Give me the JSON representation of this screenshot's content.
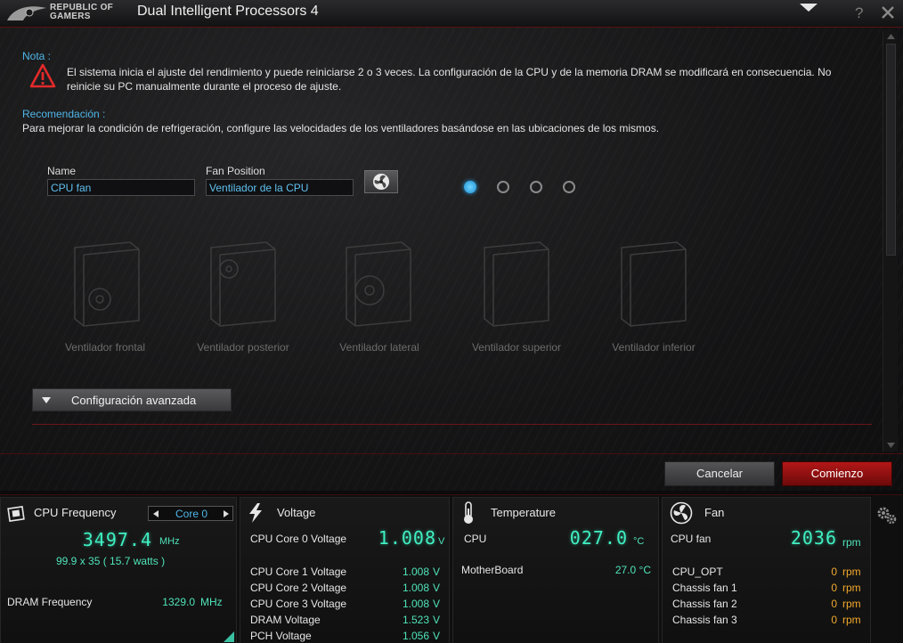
{
  "titlebar": {
    "brand_line1": "REPUBLIC OF",
    "brand_line2": "GAMERS",
    "title": "Dual Intelligent Processors 4",
    "help": "?"
  },
  "note": {
    "heading": "Nota :",
    "line1": "El sistema inicia el ajuste del rendimiento y puede reiniciarse 2 o 3 veces. La configuración de la CPU y de la memoria DRAM se modificará en consecuencia. No",
    "line2": "reinicie su PC manualmente durante el proceso de ajuste."
  },
  "recommendation": {
    "heading": "Recomendación :",
    "text": "Para mejorar la condición de refrigeración, configure las velocidades de los ventiladores basándose en las ubicaciones de los mismos."
  },
  "fan_form": {
    "name_label": "Name",
    "name_value": "CPU fan",
    "position_label": "Fan Position",
    "position_value": "Ventilador de la CPU",
    "page_dots": 4,
    "active_dot": 1
  },
  "positions": [
    {
      "label": "Ventilador frontal"
    },
    {
      "label": "Ventilador posterior"
    },
    {
      "label": "Ventilador lateral"
    },
    {
      "label": "Ventilador superior"
    },
    {
      "label": "Ventilador inferior"
    }
  ],
  "advanced": {
    "label": "Configuración avanzada"
  },
  "actions": {
    "cancel": "Cancelar",
    "start": "Comienzo"
  },
  "cpu": {
    "title": "CPU Frequency",
    "core_select": "Core 0",
    "frequency": "3497.4",
    "frequency_unit": "MHz",
    "detail": "99.9  x  35  ( 15.7  watts )",
    "dram_label": "DRAM Frequency",
    "dram_value": "1329.0",
    "dram_unit": "MHz"
  },
  "voltage": {
    "title": "Voltage",
    "main_label": "CPU Core 0 Voltage",
    "main_value": "1.008",
    "main_unit": "V",
    "rows": [
      {
        "label": "CPU Core 1 Voltage",
        "value": "1.008",
        "unit": "V"
      },
      {
        "label": "CPU Core 2 Voltage",
        "value": "1.008",
        "unit": "V"
      },
      {
        "label": "CPU Core 3 Voltage",
        "value": "1.008",
        "unit": "V"
      },
      {
        "label": "DRAM Voltage",
        "value": "1.523",
        "unit": "V"
      },
      {
        "label": "PCH Voltage",
        "value": "1.056",
        "unit": "V"
      }
    ]
  },
  "temperature": {
    "title": "Temperature",
    "main_label": "CPU",
    "main_value": "027.0",
    "main_unit": "°C",
    "board_label": "MotherBoard",
    "board_value": "27.0 °C"
  },
  "fan": {
    "title": "Fan",
    "main_label": "CPU fan",
    "main_value": "2036",
    "main_unit": "rpm",
    "rows": [
      {
        "label": "CPU_OPT",
        "value": "0",
        "unit": "rpm"
      },
      {
        "label": "Chassis fan 1",
        "value": "0",
        "unit": "rpm"
      },
      {
        "label": "Chassis fan 2",
        "value": "0",
        "unit": "rpm"
      },
      {
        "label": "Chassis fan 3",
        "value": "0",
        "unit": "rpm"
      }
    ]
  },
  "colors": {
    "accent_blue": "#4fb6e8",
    "value_green": "#3ff0c2",
    "orange": "#f2a92c",
    "brand_red": "#b31717"
  }
}
